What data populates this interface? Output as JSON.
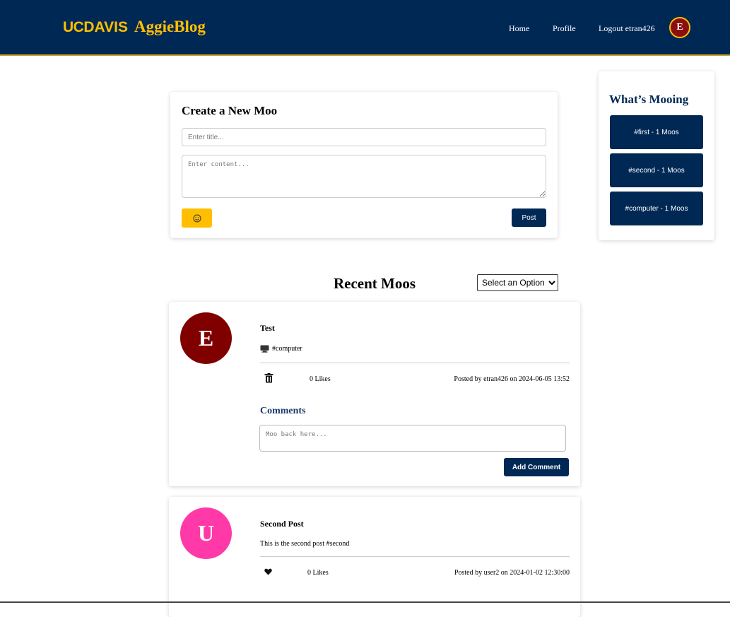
{
  "header": {
    "logo_uc": "UC",
    "logo_davis": "DAVIS",
    "logo_blog": "AggieBlog",
    "nav_home": "Home",
    "nav_profile": "Profile",
    "nav_logout": "Logout etran426",
    "avatar_letter": "E"
  },
  "create": {
    "title": "Create a New Moo",
    "title_placeholder": "Enter title...",
    "content_placeholder": "Enter content...",
    "emoji_icon": "☺",
    "post_label": "Post"
  },
  "trending": {
    "title": "What’s Mooing",
    "items": [
      {
        "label": "#first - 1 Moos"
      },
      {
        "label": "#second - 1 Moos"
      },
      {
        "label": "#computer - 1 Moos"
      }
    ]
  },
  "feed": {
    "title": "Recent Moos",
    "sort_selected": "Select an Option"
  },
  "posts": [
    {
      "avatar_letter": "E",
      "avatar_color": "#800000",
      "title": "Test",
      "icon": "computer-icon",
      "body": "#computer",
      "action_icon": "trash-icon",
      "likes": "0 Likes",
      "posted": "Posted by etran426 on 2024-06-05 13:52",
      "comments_title": "Comments",
      "comment_placeholder": "Moo back here...",
      "comment_button": "Add Comment"
    },
    {
      "avatar_letter": "U",
      "avatar_color": "#ff3aa8",
      "title": "Second Post",
      "body": "This is the second post #second",
      "action_icon": "heart-icon",
      "likes": "0 Likes",
      "posted": "Posted by user2 on 2024-01-02 12:30:00"
    }
  ],
  "colors": {
    "navy": "#002855",
    "gold": "#FFBF00"
  }
}
